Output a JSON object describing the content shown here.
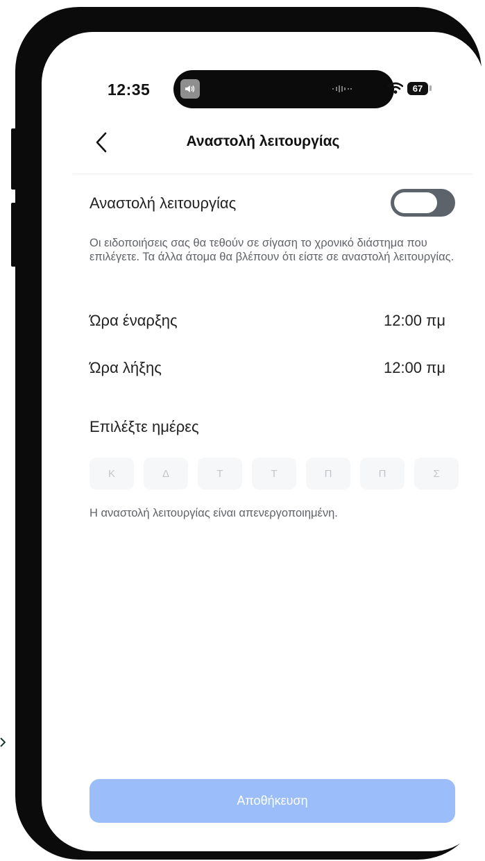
{
  "status_bar": {
    "time": "12:35",
    "battery": "67"
  },
  "nav": {
    "title": "Αναστολή λειτουργίας"
  },
  "pause": {
    "label": "Αναστολή λειτουργίας",
    "enabled": false,
    "description": "Οι ειδοποιήσεις σας θα τεθούν σε σίγαση το χρονικό διάστημα που επιλέγετε. Τα άλλα άτομα θα βλέπουν ότι είστε σε αναστολή λειτουργίας."
  },
  "start_time": {
    "label": "Ώρα έναρξης",
    "value": "12:00 πμ"
  },
  "end_time": {
    "label": "Ώρα λήξης",
    "value": "12:00 πμ"
  },
  "days": {
    "label": "Επιλέξτε ημέρες",
    "items": [
      "Κ",
      "Δ",
      "Τ",
      "Τ",
      "Π",
      "Π",
      "Σ"
    ]
  },
  "note": "Η αναστολή λειτουργίας είναι απενεργοποιημένη.",
  "save_button": {
    "label": "Αποθήκευση"
  },
  "colors": {
    "accent_disabled": "#9bbefb",
    "toggle_off": "#5d636b"
  }
}
